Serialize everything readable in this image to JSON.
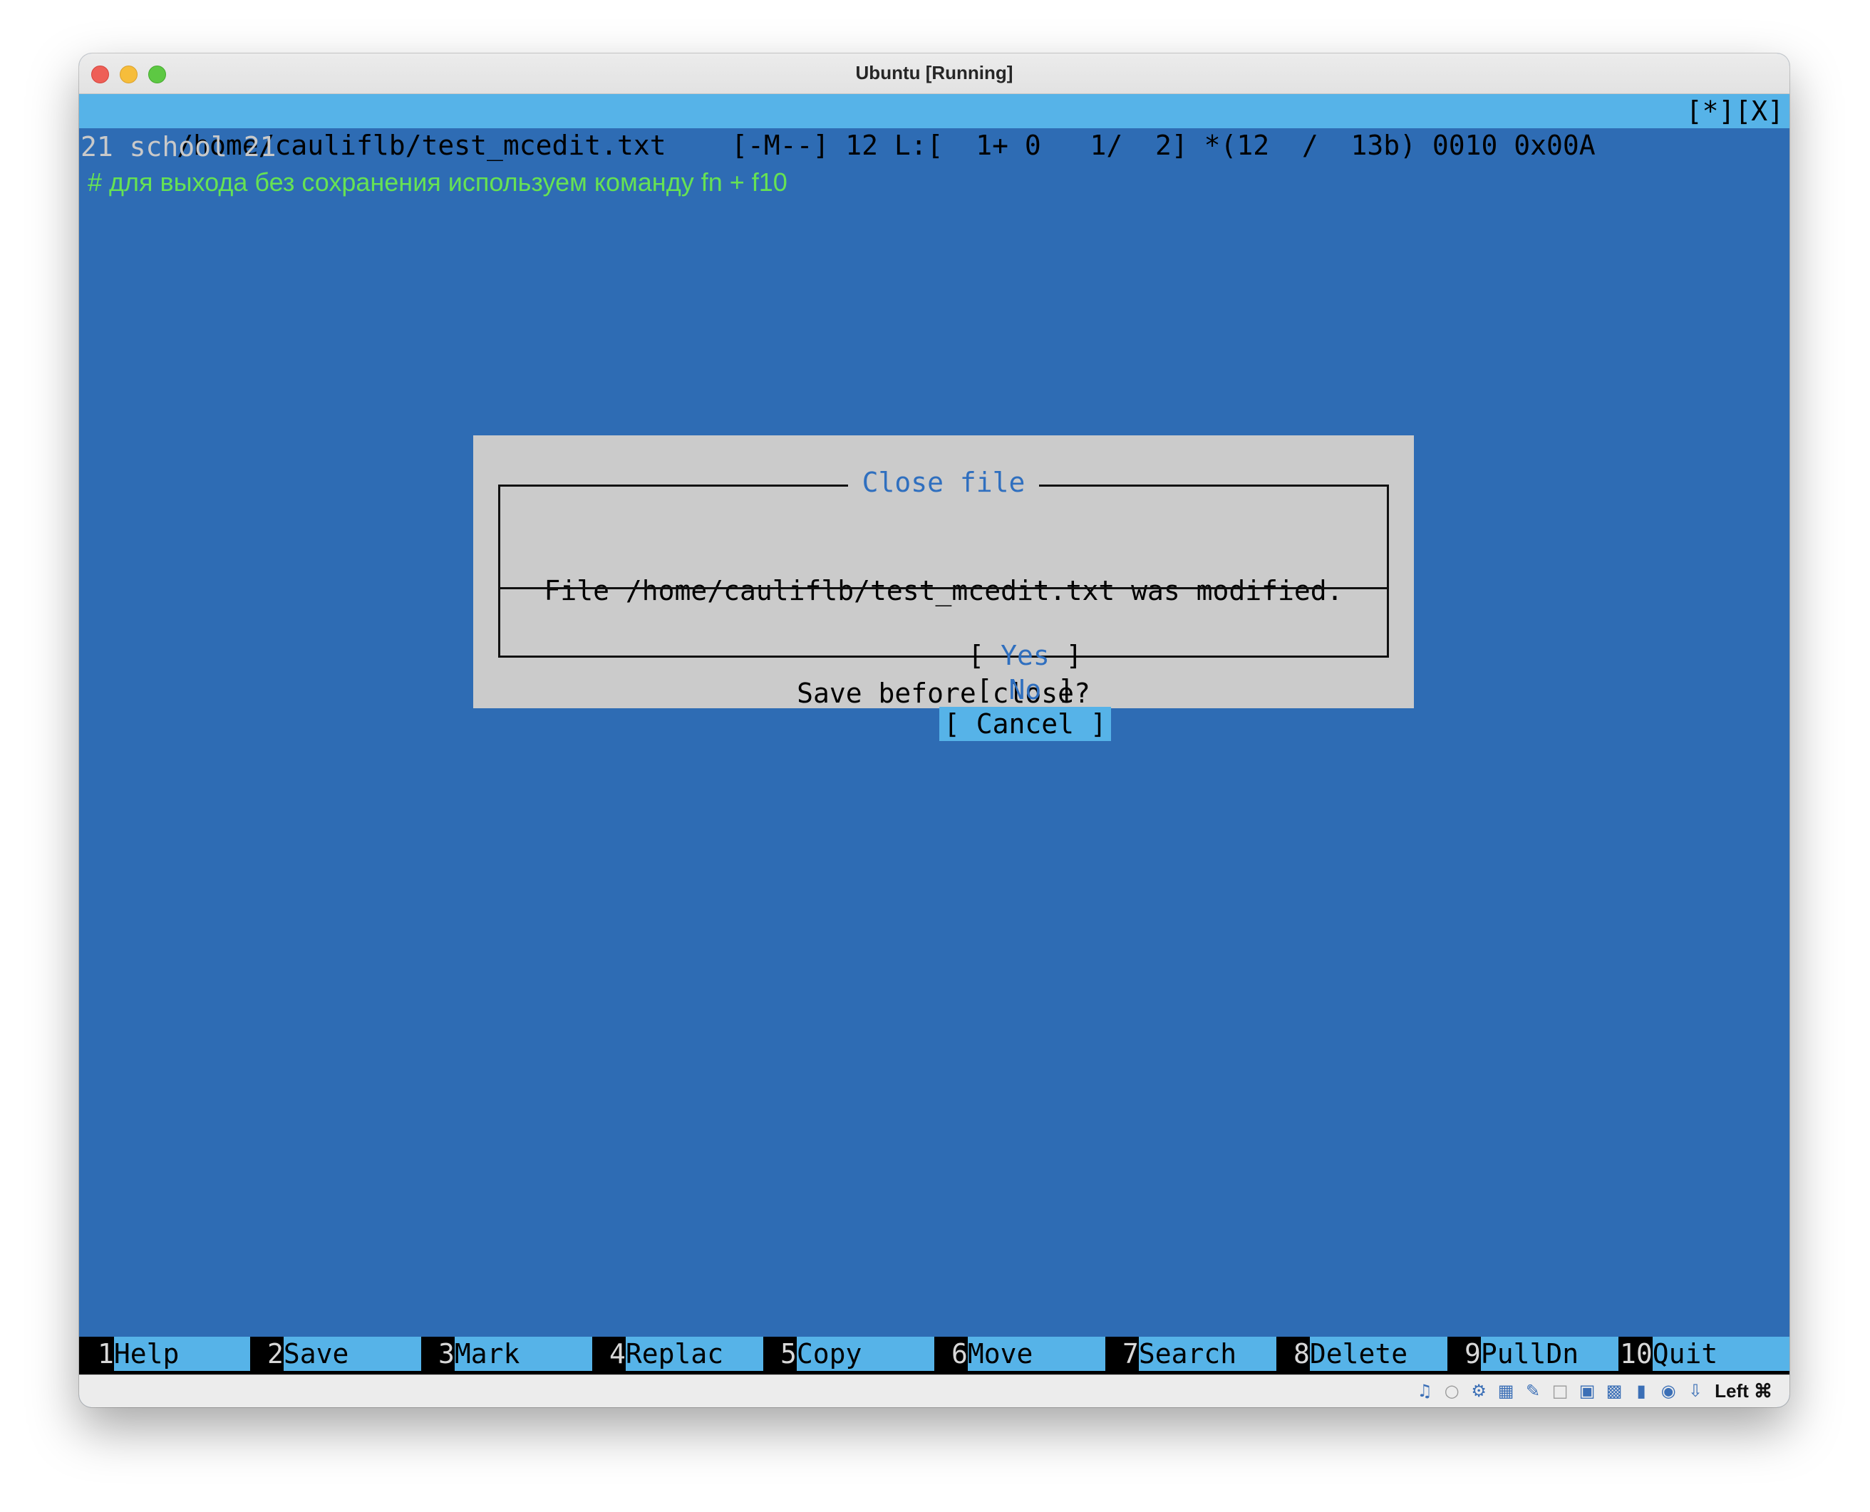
{
  "window": {
    "title": "Ubuntu [Running]"
  },
  "editor": {
    "status_left": "/home/cauliflb/test_mcedit.txt    [-M--] 12 L:[  1+ 0   1/  2] *(12  /  13b) 0010 0x00A",
    "status_right": "[*][X]",
    "lines": [
      "21 school 21",
      "# для выхода без сохранения используем команду fn + f10"
    ]
  },
  "dialog": {
    "title": "Close file",
    "message_line1": "File /home/cauliflb/test_mcedit.txt was modified.",
    "message_line2": "Save before close?",
    "buttons": {
      "yes": {
        "open": "[ ",
        "label": "Yes",
        "close": " ]"
      },
      "no": {
        "open": "[ ",
        "label": "No",
        "close": " ]"
      },
      "cancel": {
        "open": "[ ",
        "label": "Cancel",
        "close": " ]"
      }
    }
  },
  "keybar": [
    {
      "num": "1",
      "label": "Help"
    },
    {
      "num": "2",
      "label": "Save"
    },
    {
      "num": "3",
      "label": "Mark"
    },
    {
      "num": "4",
      "label": "Replac"
    },
    {
      "num": "5",
      "label": "Copy"
    },
    {
      "num": "6",
      "label": "Move"
    },
    {
      "num": "7",
      "label": "Search"
    },
    {
      "num": "8",
      "label": "Delete"
    },
    {
      "num": "9",
      "label": "PullDn"
    },
    {
      "num": "10",
      "label": "Quit"
    }
  ],
  "vm_statusbar": {
    "host_key": "Left ⌘",
    "icons": [
      "audio-icon",
      "optical-drive-icon",
      "usb-icon",
      "network-icon",
      "shared-folders-icon",
      "display-icon",
      "screen-capture-icon",
      "mouse-integration-icon",
      "cpu-icon",
      "keyboard-icon",
      "download-icon"
    ]
  },
  "colors": {
    "terminal_bg": "#2e6cb4",
    "statusbar_bg": "#56b3e8",
    "comment_green": "#66e253",
    "dialog_bg": "#cbcbcb",
    "dialog_accent": "#2f6fbf"
  }
}
